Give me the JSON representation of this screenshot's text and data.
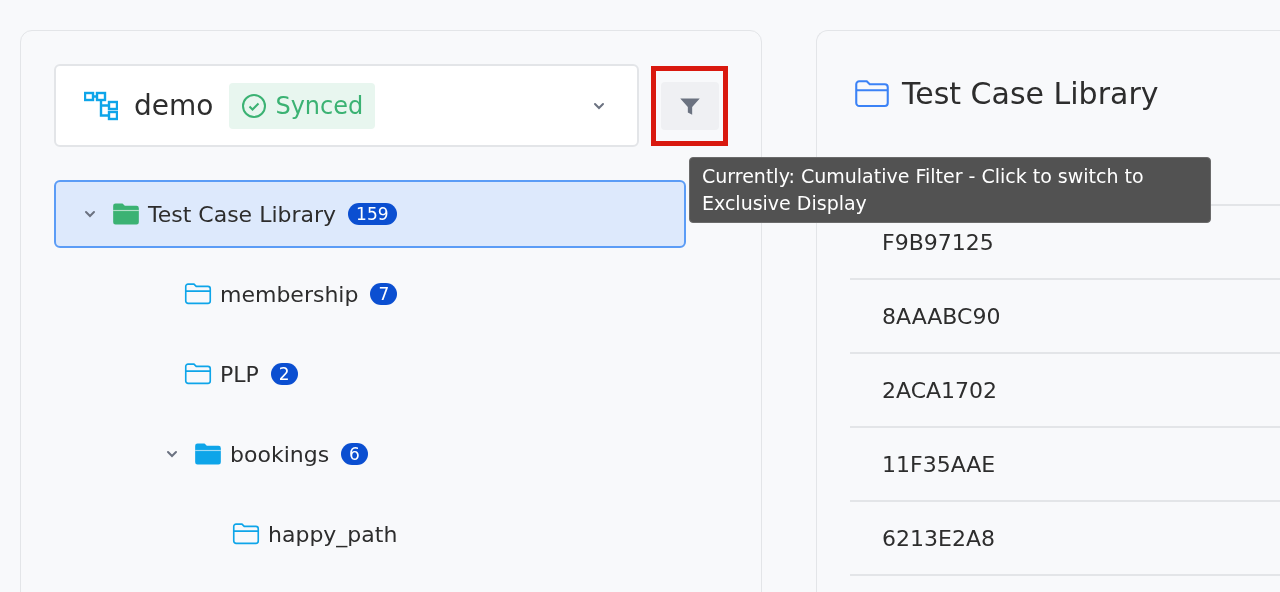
{
  "project_selector": {
    "name": "demo",
    "status": "Synced"
  },
  "filter_button": {
    "highlighted": true,
    "tooltip": "Currently: Cumulative Filter - Click to switch to Exclusive Display"
  },
  "tree": [
    {
      "label": "Test Case Library",
      "count": "159",
      "expanded": true,
      "selected": true,
      "children": [
        {
          "label": "membership",
          "count": "7",
          "selected": false
        },
        {
          "label": "PLP",
          "count": "2",
          "selected": false
        },
        {
          "label": "bookings",
          "count": "6",
          "expanded": true,
          "selected": false,
          "children": [
            {
              "label": "happy_path",
              "selected": false
            }
          ]
        }
      ]
    }
  ],
  "detail": {
    "title": "Test Case Library",
    "rows": [
      "F9B97125",
      "8AAABC90",
      "2ACA1702",
      "11F35AAE",
      "6213E2A8"
    ]
  }
}
